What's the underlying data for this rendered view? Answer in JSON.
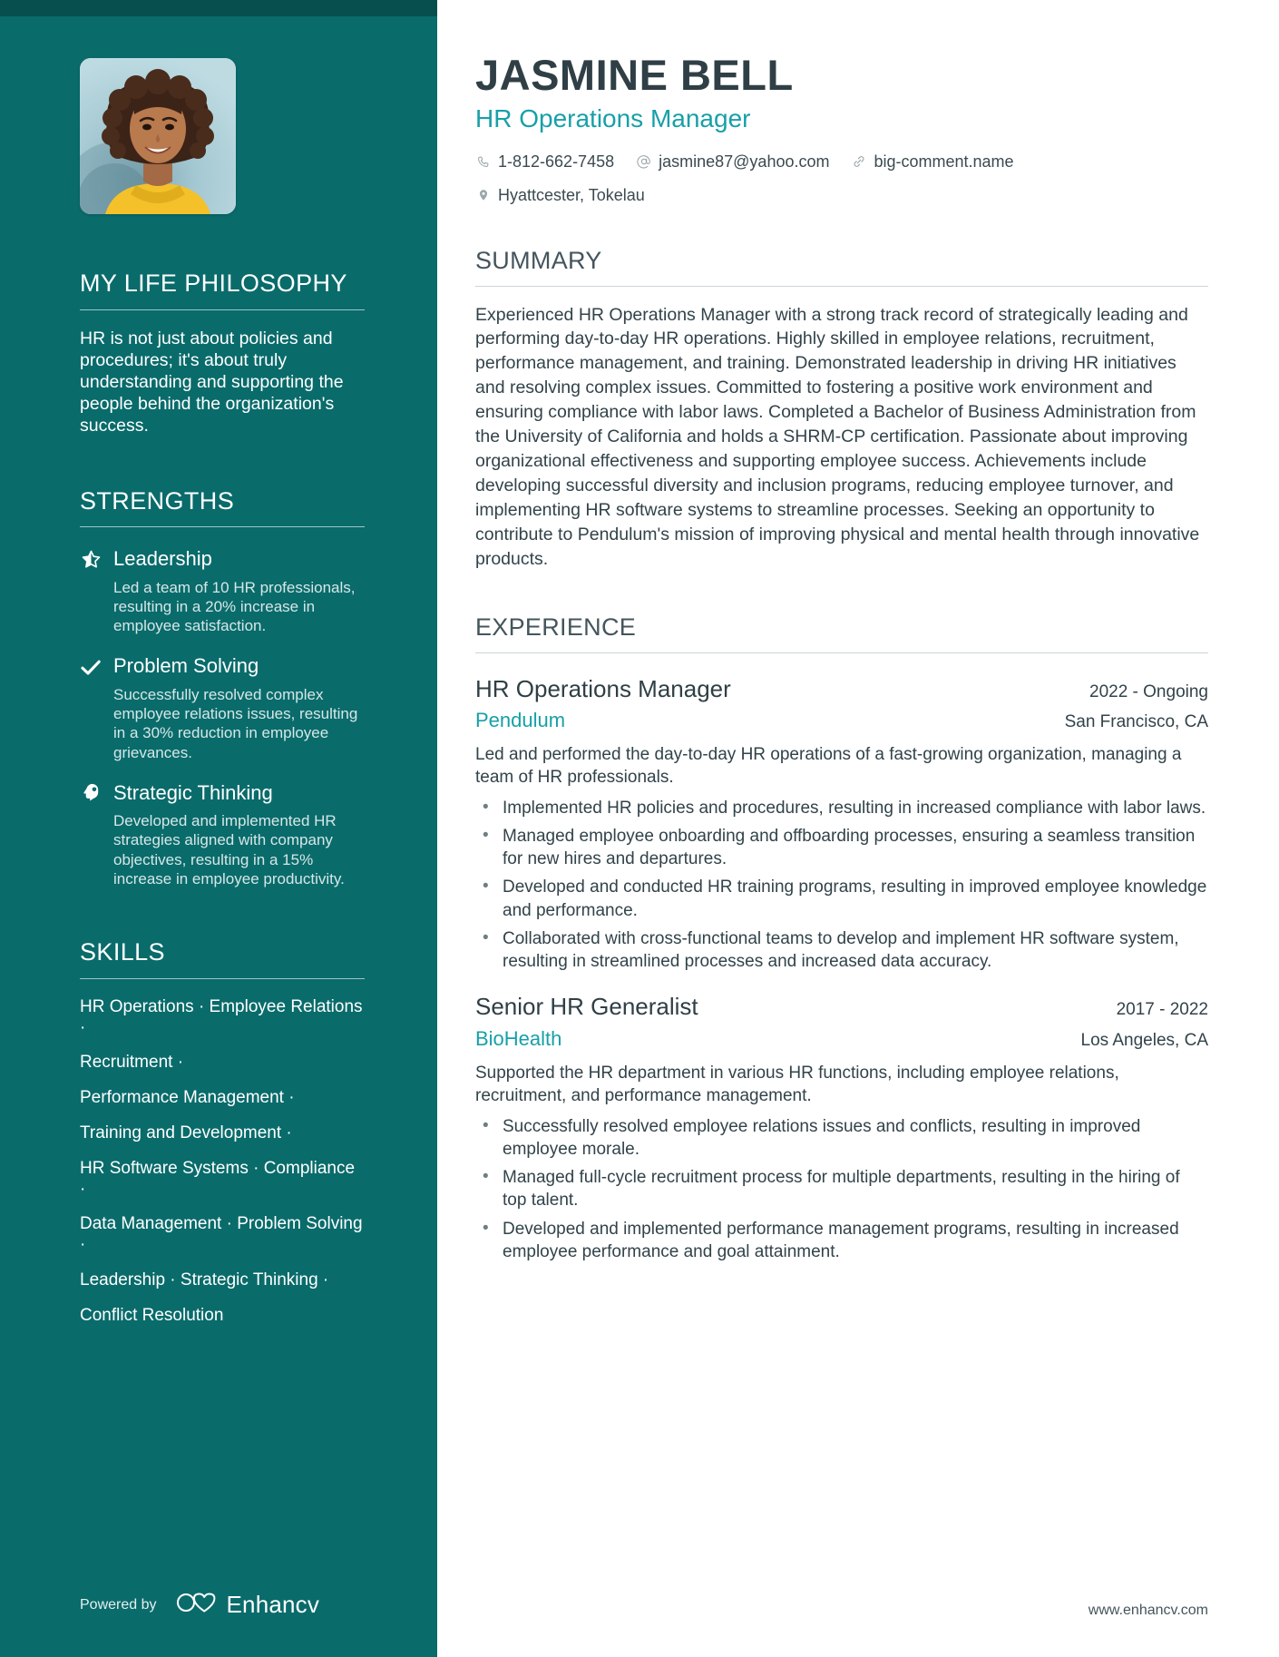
{
  "header": {
    "name": "JASMINE BELL",
    "role": "HR Operations Manager",
    "phone": "1-812-662-7458",
    "email": "jasmine87@yahoo.com",
    "website": "big-comment.name",
    "location": "Hyattcester, Tokelau",
    "phone_icon": "phone-icon",
    "email_icon": "at-icon",
    "website_icon": "link-icon",
    "location_icon": "map-pin-icon"
  },
  "sidebar": {
    "philosophy": {
      "heading": "MY LIFE PHILOSOPHY",
      "text": "HR is not just about policies and procedures; it's about truly understanding and supporting the people behind the organization's success."
    },
    "strengths": {
      "heading": "STRENGTHS",
      "items": [
        {
          "icon": "star-half-icon",
          "title": "Leadership",
          "desc": "Led a team of 10 HR professionals, resulting in a 20% increase in employee satisfaction."
        },
        {
          "icon": "check-icon",
          "title": "Problem Solving",
          "desc": "Successfully resolved complex employee relations issues, resulting in a 30% reduction in employee grievances."
        },
        {
          "icon": "head-brain-icon",
          "title": "Strategic Thinking",
          "desc": "Developed and implemented HR strategies aligned with company objectives, resulting in a 15% increase in employee productivity."
        }
      ]
    },
    "skills": {
      "heading": "SKILLS",
      "lines": [
        "HR Operations · Employee Relations ·",
        "Recruitment ·",
        "Performance Management ·",
        "Training and Development ·",
        "HR Software Systems · Compliance ·",
        "Data Management · Problem Solving ·",
        "Leadership · Strategic Thinking ·",
        "Conflict Resolution"
      ]
    },
    "footer": {
      "powered_label": "Powered by",
      "brand": "Enhancv",
      "brand_icon": "enhancv-logo-icon"
    }
  },
  "main": {
    "summary": {
      "heading": "SUMMARY",
      "text": "Experienced HR Operations Manager with a strong track record of strategically leading and performing day-to-day HR operations. Highly skilled in employee relations, recruitment, performance management, and training. Demonstrated leadership in driving HR initiatives and resolving complex issues. Committed to fostering a positive work environment and ensuring compliance with labor laws. Completed a Bachelor of Business Administration from the University of California and holds a SHRM-CP certification. Passionate about improving organizational effectiveness and supporting employee success. Achievements include developing successful diversity and inclusion programs, reducing employee turnover, and implementing HR software systems to streamline processes. Seeking an opportunity to contribute to Pendulum's mission of improving physical and mental health through innovative products."
    },
    "experience": {
      "heading": "EXPERIENCE",
      "jobs": [
        {
          "title": "HR Operations Manager",
          "company": "Pendulum",
          "date": "2022 - Ongoing",
          "location": "San Francisco, CA",
          "summary": "Led and performed the day-to-day HR operations of a fast-growing organization, managing a team of HR professionals.",
          "bullets": [
            "Implemented HR policies and procedures, resulting in increased compliance with labor laws.",
            "Managed employee onboarding and offboarding processes, ensuring a seamless transition for new hires and departures.",
            "Developed and conducted HR training programs, resulting in improved employee knowledge and performance.",
            "Collaborated with cross-functional teams to develop and implement HR software system, resulting in streamlined processes and increased data accuracy."
          ]
        },
        {
          "title": "Senior HR Generalist",
          "company": "BioHealth",
          "date": "2017 - 2022",
          "location": "Los Angeles, CA",
          "summary": "Supported the HR department in various HR functions, including employee relations, recruitment, and performance management.",
          "bullets": [
            "Successfully resolved employee relations issues and conflicts, resulting in improved employee morale.",
            "Managed full-cycle recruitment process for multiple departments, resulting in the hiring of top talent.",
            "Developed and implemented performance management programs, resulting in increased employee performance and goal attainment."
          ]
        }
      ]
    },
    "site_url": "www.enhancv.com"
  },
  "colors": {
    "sidebar_bg": "#0a6b6b",
    "sidebar_topbar": "#074f4f",
    "accent_teal": "#17a0a8",
    "heading_dark": "#2f3f45",
    "body_text": "#32434a"
  }
}
